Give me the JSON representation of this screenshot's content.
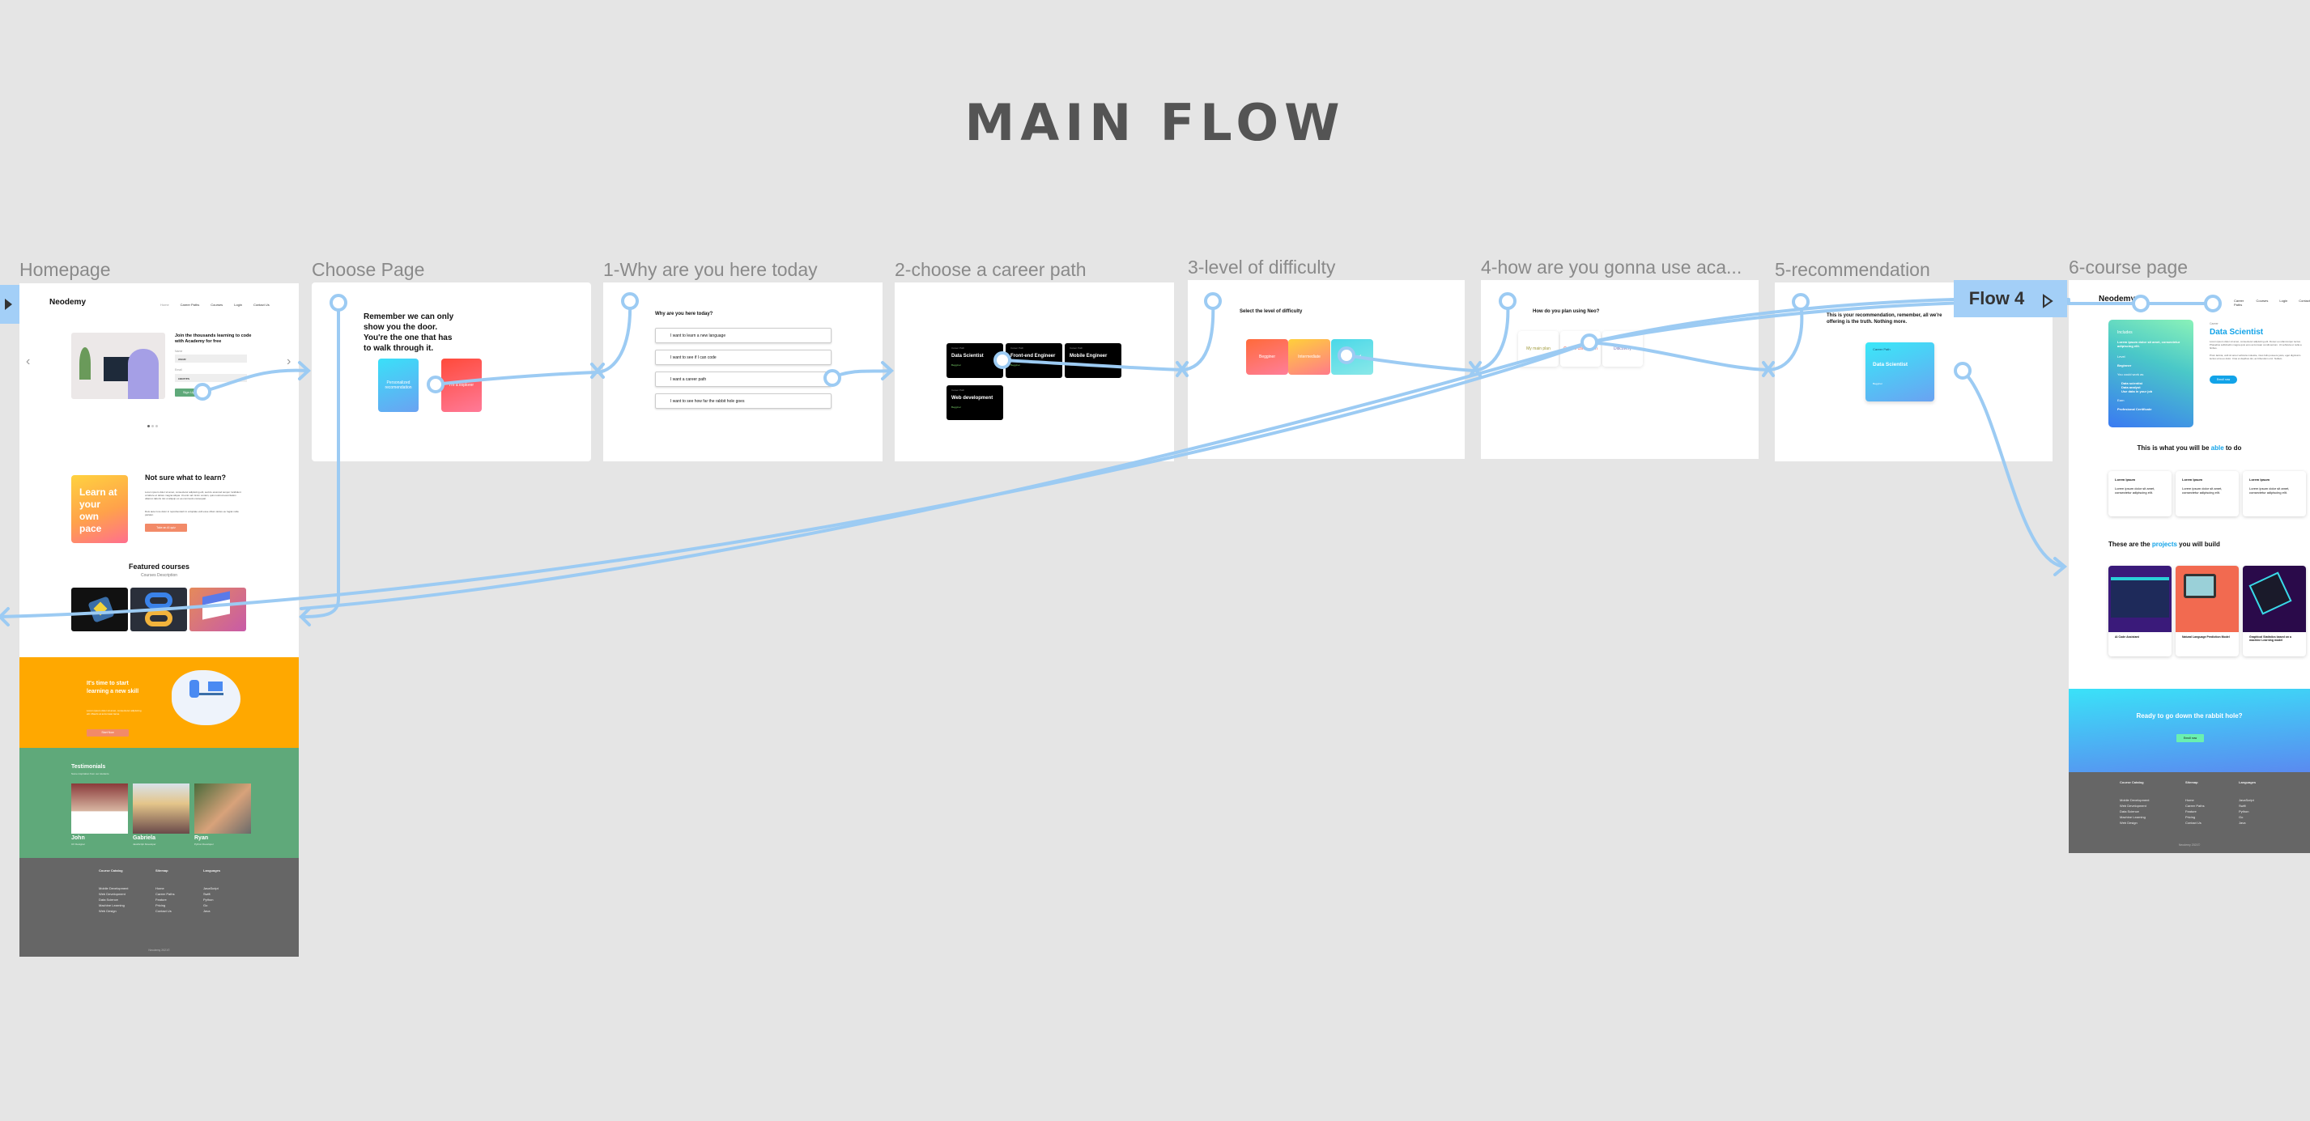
{
  "page_title": "MAIN FLOW",
  "flow_tags": {
    "flow4": "Flow 4"
  },
  "frames": [
    {
      "label": "Homepage"
    },
    {
      "label": "Choose Page"
    },
    {
      "label": "1-Why are you here today"
    },
    {
      "label": "2-choose a career path"
    },
    {
      "label": "3-level of difficulty"
    },
    {
      "label": "4-how are you gonna use aca..."
    },
    {
      "label": "5-recommendation"
    },
    {
      "label": "6-course page"
    }
  ],
  "homepage": {
    "logo": "Neodemy",
    "nav": [
      "Home",
      "Career Paths",
      "Courses",
      "Login",
      "Contact Us"
    ],
    "hero_heading": "Join the thousands learning to code with Academy for free",
    "name_label": "Name",
    "name_value": "oscar",
    "email_label": "Email",
    "email_value": "caceres",
    "signup_button": "Sign Up",
    "prev": "‹",
    "next": "›",
    "promo_card": "Learn at your own pace",
    "promo_heading": "Not sure what to learn?",
    "promo_p1": "Lorem ipsum dolor sit amet, consectetur adipiscing elit, sed do eiusmod tempor incididunt ut labore et dolore magna aliqua. Ut enim ad minim veniam, quis nostrud exercitation ullamco laboris nisi ut aliquip ex ea commodo consequat.",
    "promo_p2": "Duis aute irure dolor in reprehenderit in voluptate velit esse cillum dolore eu fugiat nulla pariatur.",
    "quiz_button": "Take an AI quiz",
    "featured_title": "Featured courses",
    "featured_sub": "Courses Description",
    "cta_heading": "It's time to start learning a new skill",
    "cta_text": "Lorem ipsum dolor sit amet, consectetur adipiscing elit. Mauris at accumsan lacus.",
    "cta_button": "Start Now",
    "testimonials_title": "Testimonials",
    "testimonials_sub": "Some inspiration from our students",
    "testimonials": [
      {
        "name": "John",
        "role": "UX Designer"
      },
      {
        "name": "Gabriela",
        "role": "JavaScript Developer"
      },
      {
        "name": "Ryan",
        "role": "Python Developer"
      }
    ],
    "footer": {
      "cols": [
        {
          "title": "Course Catalog",
          "items": [
            "Mobile Development",
            "Web Development",
            "Data Science",
            "Machine Learning",
            "Web Design"
          ]
        },
        {
          "title": "Sitemap",
          "items": [
            "Home",
            "Career Paths",
            "Feature",
            "Pricing",
            "Contact Us"
          ]
        },
        {
          "title": "Languages",
          "items": [
            "JavaScript",
            "Swift",
            "Python",
            "Go",
            "Java"
          ]
        }
      ],
      "copyright": "Neodemy 2021©"
    }
  },
  "choose": {
    "quote": "Remember we can only show you the door. You're the one that has to walk through it.",
    "option_a": "Personalized recomendation",
    "option_b": "I'm a explorer"
  },
  "why": {
    "question": "Why are you here today?",
    "options": [
      "I want to learn a new language",
      "I want to see if I can code",
      "I want a career path",
      "I want to see how far the rabbit hole goes"
    ]
  },
  "career": {
    "cards": [
      {
        "sub": "Career Path",
        "title": "Data Scientist",
        "level": "Begginer",
        "color": "#7bd36b"
      },
      {
        "sub": "Career Path",
        "title": "Front-end Engineer",
        "level": "Begginer",
        "color": "#7bd36b"
      },
      {
        "sub": "Career Path",
        "title": "Mobile Engineer",
        "level": "Intermediate",
        "color": "#f07a5a"
      },
      {
        "sub": "Career Path",
        "title": "Web development",
        "level": "Begginer",
        "color": "#7bd36b"
      }
    ]
  },
  "difficulty": {
    "question": "Select the level of difficulty",
    "levels": [
      "Begginer",
      "Intermediate",
      "Advanced"
    ]
  },
  "use": {
    "question": "How do you plan using Neo?",
    "options": [
      {
        "label": "My main plan",
        "color": "#a09a3a"
      },
      {
        "label": "Course completion",
        "color": "#e2504a"
      },
      {
        "label": "Discovery",
        "color": "#6a6ab0"
      }
    ]
  },
  "recommendation": {
    "text": "This is your recommendation, remember, all we're offering is the truth. Nothing more.",
    "card_sub": "Career Path",
    "card_title": "Data Scientist",
    "card_level": "Begginer"
  },
  "course": {
    "logo": "Neodemy",
    "nav": [
      "Career Paths",
      "Courses",
      "Login",
      "Contact"
    ],
    "includes_title": "Includes",
    "includes_text": "Lorem ipsum dolor sit amet, consectetur adipiscing elit.",
    "level_label": "Level",
    "level_value": "Beginner",
    "work_label": "You could work as",
    "work_items": [
      "Data scientist",
      "Data analyst",
      "Use data in your job"
    ],
    "earn_label": "Earn",
    "earn_value": "Profesional Certificate",
    "eyebrow": "Career",
    "title": "Data Scientist",
    "p1": "Lorem ipsum dolor sit amet, consectetur adipiscing elit. Donec eu ullamcorper lectus. Phasellus sollicitudin magna quis eros accumsan condimentum. Ut vehicula ut nulla a finibus.",
    "p2": "Proin lacinia, velit sit amet vehicula molestie, risus felis posuere justo, eget dignissim lectus urna eu dolor. Cras et dapibus dui, ac bibendum orci. Nullam.",
    "enroll_button": "Enroll now",
    "able_pre": "This is what you will be ",
    "able_hl": "able",
    "able_post": " to do",
    "features": [
      {
        "title": "Lorem Ipsum",
        "text": "Lorem ipsum dolor sit amet, consectetur adipiscing elit."
      },
      {
        "title": "Lorem Ipsum",
        "text": "Lorem ipsum dolor sit amet, consectetur adipiscing elit."
      },
      {
        "title": "Lorem Ipsum",
        "text": "Lorem ipsum dolor sit amet, consectetur adipiscing elit."
      }
    ],
    "proj_pre": "These are the ",
    "proj_hl": "projects",
    "proj_post": " you will build",
    "projects": [
      "AI Code Assistant",
      "Natural Language Prediction Model",
      "Graphical Statistics based on a machine Learning model"
    ],
    "cta_heading": "Ready to go down the rabbit hole?",
    "cta_button": "Enroll now",
    "footer": {
      "cols": [
        {
          "title": "Course Catalog",
          "items": [
            "Mobile Development",
            "Web Development",
            "Data Science",
            "Machine Learning",
            "Web Design"
          ]
        },
        {
          "title": "Sitemap",
          "items": [
            "Home",
            "Career Paths",
            "Feature",
            "Pricing",
            "Contact Us"
          ]
        },
        {
          "title": "Languages",
          "items": [
            "JavaScript",
            "Swift",
            "Python",
            "Go",
            "Java"
          ]
        }
      ],
      "copyright": "Neodemy 2021©"
    }
  },
  "colors": {
    "background": "#e5e5e5",
    "connector": "#9ccbf3",
    "accent": "#12a3e8",
    "orange": "#ffa800",
    "green": "#5fa97a",
    "footer": "#666666"
  }
}
